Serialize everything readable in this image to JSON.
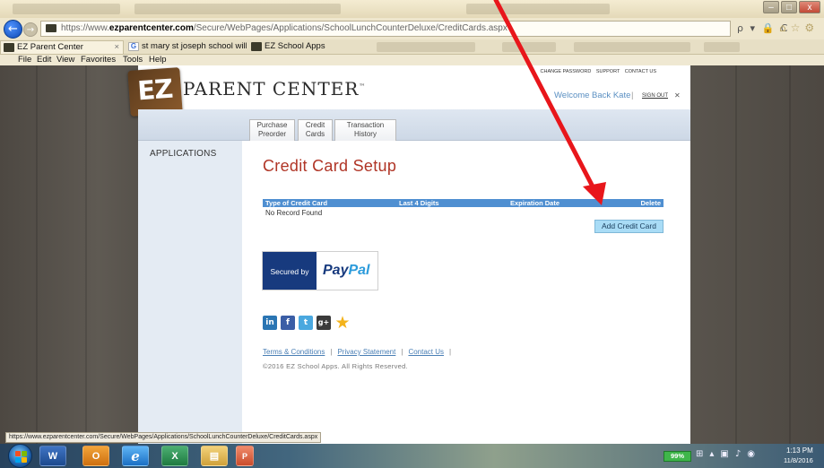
{
  "browser": {
    "url_prefix": "https://www.",
    "url_host": "ezparentcenter.com",
    "url_path": "/Secure/WebPages/Applications/SchoolLunchCounterDeluxe/CreditCards.aspx",
    "addr_tools": "ρ ▾ 🔒 C",
    "tabs": [
      {
        "label": "EZ Parent Center",
        "close": "×"
      },
      {
        "label": "st mary st joseph school willim..."
      },
      {
        "label": "EZ School Apps"
      }
    ],
    "menu": [
      "File",
      "Edit",
      "View",
      "Favorites",
      "Tools",
      "Help"
    ],
    "window_controls": [
      "–",
      "□",
      "x"
    ],
    "status_url": "https://www.ezparentcenter.com/Secure/WebPages/Applications/SchoolLunchCounterDeluxe/CreditCards.aspx"
  },
  "site": {
    "logo_mark": "EZ",
    "logo_text": "PARENT CENTER",
    "logo_tm": "™",
    "top_links": [
      "CHANGE PASSWORD",
      "SUPPORT",
      "CONTACT US"
    ],
    "welcome": "Welcome Back Kate",
    "welcome_sep": "|",
    "sign_out": "SIGN OUT",
    "sign_out_icon": "✕",
    "nav_tabs": [
      {
        "line1": "Purchase",
        "line2": "Preorder"
      },
      {
        "line1": "Credit",
        "line2": "Cards"
      },
      {
        "line1": "Transaction",
        "line2": "History"
      }
    ],
    "sidebar_label": "APPLICATIONS"
  },
  "main": {
    "title": "Credit Card Setup",
    "table_columns": [
      "Type of Credit Card",
      "Last 4 Digits",
      "Expiration Date",
      "Delete"
    ],
    "empty_message": "No Record Found",
    "add_button": "Add Credit Card",
    "paypal_secured": "Secured by",
    "paypal_pay": "Pay",
    "paypal_pal": "Pal"
  },
  "footer": {
    "links": [
      "Terms & Conditions",
      "Privacy Statement",
      "Contact Us"
    ],
    "sep": "|",
    "copyright": "©2016 EZ School Apps. All Rights Reserved."
  },
  "social": {
    "linkedin": "in",
    "facebook": "f",
    "twitter": "t",
    "gplus": "g+",
    "favorite": "★"
  },
  "taskbar": {
    "word": "W",
    "outlook": "O",
    "ie": "e",
    "excel": "X",
    "explorer": "▤",
    "ps": "P",
    "battery": "99%",
    "time": "1:13 PM",
    "date": "11/8/2016"
  },
  "colors": {
    "accent_blue": "#4f8fd1",
    "title_red": "#b03526",
    "button_cyan": "#a9dcf6",
    "annotation_red": "#e8161b"
  }
}
